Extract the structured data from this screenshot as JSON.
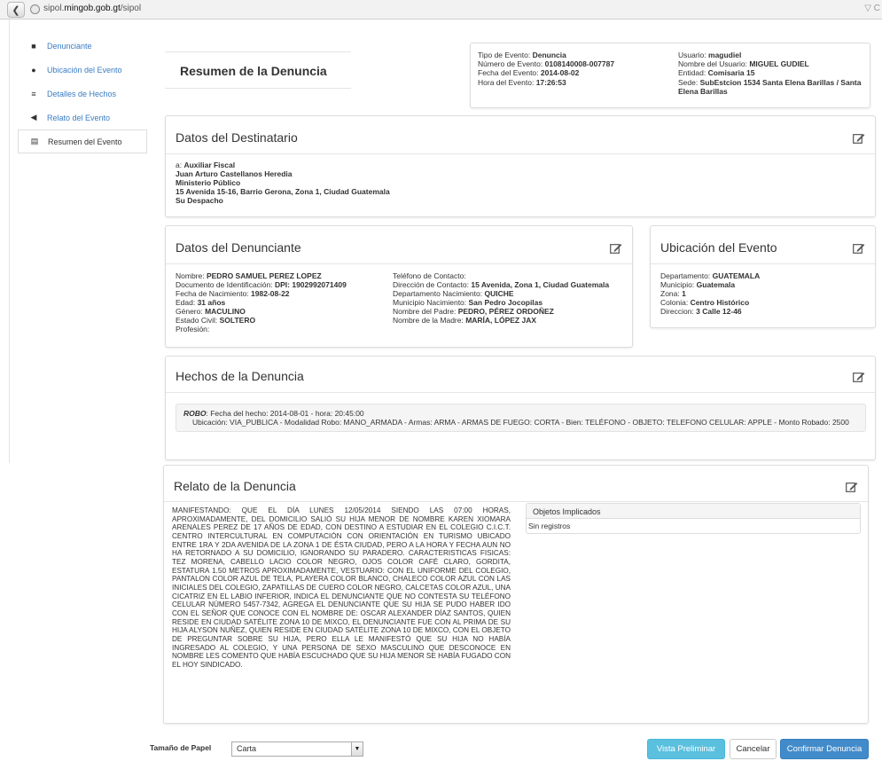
{
  "browser": {
    "url_host": "sipol.",
    "url_domain": "mingob.gob.gt",
    "url_path": "/sipol",
    "url_end": "▽ C"
  },
  "sidebar": {
    "items": [
      {
        "label": "Denunciante",
        "icon": "user-icon"
      },
      {
        "label": "Ubicación del Evento",
        "icon": "map-marker-icon"
      },
      {
        "label": "Detalles de Hechos",
        "icon": "list-icon"
      },
      {
        "label": "Relato del Evento",
        "icon": "bullhorn-icon"
      },
      {
        "label": "Resumen del Evento",
        "icon": "print-icon"
      }
    ]
  },
  "page_title": "Resumen de la Denuncia",
  "meta": {
    "tipo_label": "Tipo de Evento: ",
    "tipo": "Denuncia",
    "numero_label": "Número de Evento: ",
    "numero": "0108140008-007787",
    "fecha_label": "Fecha del Evento: ",
    "fecha": "2014-08-02",
    "hora_label": "Hora del Evento: ",
    "hora": "17:26:53",
    "usuario_label": "Usuario: ",
    "usuario": "magudiel",
    "nombre_usuario_label": "Nombre del Usuario: ",
    "nombre_usuario": "MIGUEL GUDIEL",
    "entidad_label": "Entidad: ",
    "entidad": "Comisaria 15",
    "sede_label": "Sede: ",
    "sede": "SubEstcion 1534 Santa Elena Barillas / Santa Elena Barillas"
  },
  "destinatario": {
    "title": "Datos del Destinatario",
    "a_label": "a: ",
    "a": "Auxiliar Fiscal",
    "nombre": "Juan Arturo Castellanos Heredia",
    "institucion": "Ministerio Público",
    "direccion": "15 Avenida 15-16, Barrio Gerona, Zona 1, Ciudad Guatemala",
    "despacho": "Su Despacho"
  },
  "denunciante": {
    "title": "Datos del Denunciante",
    "nombre_label": "Nombre: ",
    "nombre": "PEDRO SAMUEL PEREZ LOPEZ",
    "doc_label": "Documento de Identificación: ",
    "doc": "DPI: 1902992071409",
    "nac_label": "Fecha de Nacimiento: ",
    "nac": "1982-08-22",
    "edad_label": "Edad: ",
    "edad": "31 años",
    "genero_label": "Género: ",
    "genero": "MACULINO",
    "civil_label": "Estado Civil: ",
    "civil": "SOLTERO",
    "profesion_label": "Profesión:",
    "telefono_label": "Teléfono de Contacto:",
    "dir_label": "Dirección de Contacto: ",
    "dir": "15 Avenida, Zona 1, Ciudad Guatemala",
    "depto_label": "Departamento Nacimiento: ",
    "depto": "QUICHE",
    "muni_label": "Municipio Nacimiento: ",
    "muni": "San Pedro Jocopilas",
    "padre_label": "Nombre del Padre: ",
    "padre": "PEDRO, PÉREZ ORDOÑEZ",
    "madre_label": "Nombre de la Madre: ",
    "madre": "MARÍA, LÓPEZ JAX"
  },
  "ubicacion": {
    "title": "Ubicación del Evento",
    "depto_label": "Departamento: ",
    "depto": "GUATEMALA",
    "muni_label": "Municipio: ",
    "muni": "Guatemala",
    "zona_label": "Zona: ",
    "zona": "1",
    "colonia_label": "Colonia: ",
    "colonia": "Centro Histórico",
    "dir_label": "Direccion: ",
    "dir": "3 Calle 12-46"
  },
  "hechos": {
    "title": "Hechos de la Denuncia",
    "tipo": "ROBO",
    "line1": ": Fecha del hecho: 2014-08-01 - hora: 20:45:00",
    "line2": "Ubicación: VIA_PUBLICA - Modalidad Robo: MANO_ARMADA - Armas: ARMA - ARMAS DE FUEGO: CORTA - Bien: TELÉFONO - OBJETO: TELEFONO CELULAR: APPLE - Monto Robado: 2500"
  },
  "relato": {
    "title": "Relato de la Denuncia",
    "text": "MANIFESTANDO: QUE EL DÍA LUNES 12/05/2014 SIENDO LAS 07:00 HORAS, APROXIMADAMENTE, DEL DOMICILIO SALIÓ SU HIJA MENOR DE NOMBRE KAREN XIOMARA ARENALES PEREZ DE 17 AÑOS DE EDAD, CON DESTINO A ESTUDIAR EN EL COLEGIO C.I.C.T. CENTRO INTERCULTURAL EN COMPUTACIÓN CON ORIENTACIÓN EN TURISMO UBICADO ENTRE 1RA Y 2DA AVENIDA DE LA ZONA 1 DE ÉSTA CIUDAD, PERO A LA HORA Y FECHA AUN NO HA RETORNADO A SU DOMICILIO, IGNORANDO SU PARADERO. CARACTERISTICAS FISICAS: TEZ MORENA, CABELLO LACIO COLOR NEGRO, OJOS COLOR CAFÉ CLARO, GORDITA, ESTATURA 1.50 METROS APROXIMADAMENTE, VESTUARIO: CON EL UNIFORME DEL COLEGIO, PANTALON COLOR AZUL DE TELA, PLAYERA COLOR BLANCO, CHALECO COLOR AZUL CON LAS INICIALES DEL COLEGIO, ZAPATILLAS DE CUERO COLOR NEGRO, CALCETAS COLOR AZUL, UNA CICATRIZ EN EL LABIO INFERIOR, INDICA EL DENUNCIANTE QUE NO CONTESTA SU TELÉFONO CELULAR NÚMERO 5457-7342, AGREGA EL DENUNCIANTE QUE SU HIJA SE PUDO HABER IDO CON EL SEÑOR QUE CONOCE CON EL NOMBRE DE: OSCAR ALEXANDER DÍAZ SANTOS, QUIEN RESIDE EN CIUDAD SATÉLITE ZONA 10 DE MIXCO, EL DENUNCIANTE FUE CON AL PRIMA DE SU HIJA ALYSON NUÑEZ, QUIEN RESIDE EN CIUDAD SATÉLITE ZONA 10 DE MIXCO, CON EL OBJETO DE PREGUNTAR SOBRE SU HIJA, PERO ELLA LE MANIFESTÓ QUE SU HIJA NO HABÍA INGRESADO AL COLEGIO, Y UNA PERSONA DE SEXO MASCULINO QUE DESCONOCE EN NOMBRE LES COMENTO QUE HABÍA ESCUCHADO QUE SU HIJA MENOR SE HABÍA FUGADO CON EL HOY SINDICADO.",
    "objetos_title": "Objetos Implicados",
    "objetos_empty": "Sin registros"
  },
  "footer": {
    "paper_label": "Tamaño de Papel",
    "paper_value": "Carta",
    "preview_label": "Vista Preliminar",
    "cancel_label": "Cancelar",
    "confirm_label": "Confirmar Denuncia"
  },
  "colors": {
    "link": "#3a7cc3",
    "info": "#5bc0de",
    "primary": "#428bca"
  }
}
